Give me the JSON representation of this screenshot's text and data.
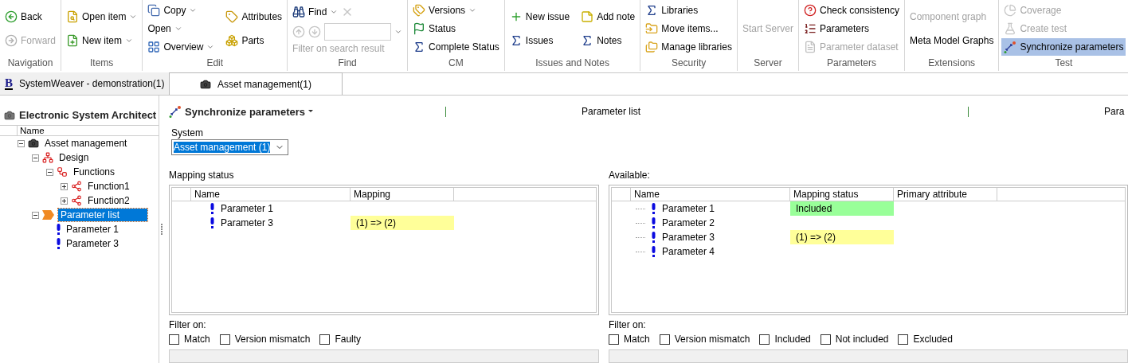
{
  "ribbon": {
    "groups": [
      {
        "label": "Navigation",
        "columns": [
          [
            {
              "kind": "button",
              "label": "Back",
              "dropdown": false,
              "disabled": false,
              "active": false
            },
            {
              "kind": "button",
              "label": "Forward",
              "dropdown": false,
              "disabled": true,
              "active": false
            }
          ]
        ]
      },
      {
        "label": "Items",
        "columns": [
          [
            {
              "kind": "button",
              "label": "Open item",
              "dropdown": true,
              "disabled": false,
              "active": false
            },
            {
              "kind": "button",
              "label": "New item",
              "dropdown": true,
              "disabled": false,
              "active": false
            }
          ]
        ]
      },
      {
        "label": "Edit",
        "columns": [
          [
            {
              "kind": "button",
              "label": "Copy",
              "dropdown": true,
              "disabled": false,
              "active": false
            },
            {
              "kind": "button",
              "label": "Open",
              "dropdown": true,
              "disabled": false,
              "active": false
            },
            {
              "kind": "button",
              "label": "Overview",
              "dropdown": true,
              "disabled": false,
              "active": false
            }
          ],
          [
            {
              "kind": "button",
              "label": "Attributes",
              "dropdown": false,
              "disabled": false,
              "active": false
            },
            {
              "kind": "button",
              "label": "Parts",
              "dropdown": false,
              "disabled": false,
              "active": false
            }
          ]
        ]
      },
      {
        "label": "Find",
        "columns": [
          [
            {
              "kind": "row",
              "items": [
                {
                  "kind": "button",
                  "label": "Find",
                  "dropdown": true,
                  "disabled": false,
                  "active": false
                },
                {
                  "kind": "icon-button",
                  "disabled": true
                }
              ]
            },
            {
              "kind": "row",
              "items": [
                {
                  "kind": "icon-button",
                  "disabled": true
                },
                {
                  "kind": "icon-button",
                  "disabled": true
                },
                {
                  "kind": "field"
                },
                {
                  "kind": "caret-button"
                }
              ]
            },
            {
              "kind": "caption",
              "label": "Filter on search result",
              "disabled": true
            }
          ]
        ]
      },
      {
        "label": "CM",
        "columns": [
          [
            {
              "kind": "button",
              "label": "Versions",
              "dropdown": true,
              "disabled": false,
              "active": false
            },
            {
              "kind": "button",
              "label": "Status",
              "dropdown": false,
              "disabled": false,
              "active": false
            },
            {
              "kind": "button",
              "label": "Complete Status",
              "dropdown": false,
              "disabled": false,
              "active": false
            }
          ]
        ]
      },
      {
        "label": "Issues and Notes",
        "columns": [
          [
            {
              "kind": "button",
              "label": "New issue",
              "dropdown": false,
              "disabled": false,
              "active": false
            },
            {
              "kind": "button",
              "label": "Issues",
              "dropdown": false,
              "disabled": false,
              "active": false
            }
          ],
          [
            {
              "kind": "button",
              "label": "Add note",
              "dropdown": false,
              "disabled": false,
              "active": false
            },
            {
              "kind": "button",
              "label": "Notes",
              "dropdown": false,
              "disabled": false,
              "active": false
            }
          ]
        ]
      },
      {
        "label": "Security",
        "columns": [
          [
            {
              "kind": "button",
              "label": "Libraries",
              "dropdown": false,
              "disabled": false,
              "active": false
            },
            {
              "kind": "button",
              "label": "Move items...",
              "dropdown": false,
              "disabled": false,
              "active": false
            },
            {
              "kind": "button",
              "label": "Manage libraries",
              "dropdown": false,
              "disabled": false,
              "active": false
            }
          ]
        ]
      },
      {
        "label": "Server",
        "columns": [
          [
            {
              "kind": "button",
              "label": "Start Server",
              "dropdown": false,
              "disabled": true,
              "active": false
            }
          ]
        ]
      },
      {
        "label": "Parameters",
        "columns": [
          [
            {
              "kind": "button",
              "label": "Check consistency",
              "dropdown": false,
              "disabled": false,
              "active": false
            },
            {
              "kind": "button",
              "label": "Parameters",
              "dropdown": false,
              "disabled": false,
              "active": false
            },
            {
              "kind": "button",
              "label": "Parameter dataset",
              "dropdown": false,
              "disabled": true,
              "active": false
            }
          ]
        ]
      },
      {
        "label": "Extensions",
        "columns": [
          [
            {
              "kind": "button",
              "label": "Component graph",
              "dropdown": false,
              "disabled": true,
              "active": false
            },
            {
              "kind": "button",
              "label": "Meta Model Graphs",
              "dropdown": false,
              "disabled": false,
              "active": false
            }
          ]
        ]
      },
      {
        "label": "Test",
        "columns": [
          [
            {
              "kind": "button",
              "label": "Coverage",
              "dropdown": false,
              "disabled": true,
              "active": false
            },
            {
              "kind": "button",
              "label": "Create test",
              "dropdown": false,
              "disabled": true,
              "active": false
            },
            {
              "kind": "button",
              "label": "Synchronize parameters",
              "dropdown": false,
              "disabled": false,
              "active": true
            }
          ]
        ]
      }
    ]
  },
  "document_tabs": [
    {
      "logo": "B",
      "label": "SystemWeaver - demonstration(1)",
      "selected": false
    },
    {
      "label": "Asset management(1)",
      "selected": true
    }
  ],
  "explorer": {
    "title": "Electronic System Architect",
    "column": "Name",
    "tree": [
      {
        "kind": "system",
        "label": "Asset management",
        "expanded": true,
        "selected": false,
        "children": [
          {
            "kind": "design",
            "label": "Design",
            "expanded": true,
            "selected": false,
            "children": [
              {
                "kind": "function-group",
                "label": "Functions",
                "expanded": true,
                "selected": false,
                "children": [
                  {
                    "kind": "function",
                    "label": "Function1",
                    "expanded": false,
                    "selected": false
                  },
                  {
                    "kind": "function",
                    "label": "Function2",
                    "expanded": false,
                    "selected": false
                  }
                ]
              }
            ]
          },
          {
            "kind": "parameter-list",
            "label": "Parameter list",
            "expanded": true,
            "selected": true,
            "children": [
              {
                "kind": "parameter",
                "label": "Parameter 1",
                "selected": false
              },
              {
                "kind": "parameter",
                "label": "Parameter 3",
                "selected": false
              }
            ]
          }
        ]
      }
    ]
  },
  "view": {
    "title": "Synchronize parameters",
    "context_labels": [
      "Parameter list",
      "Para"
    ],
    "system": {
      "label": "System",
      "value": "Asset management (1)",
      "value_selected": true
    },
    "panels": [
      {
        "label": "Mapping status",
        "columns": [
          "Name",
          "Mapping"
        ],
        "rows": [
          {
            "name": "Parameter 1"
          },
          {
            "name": "Parameter 3",
            "status": "(1) => (2)",
            "color": "#ffff99"
          }
        ],
        "filter_label": "Filter on:",
        "filters": [
          {
            "label": "Match",
            "checked": false
          },
          {
            "label": "Version mismatch",
            "checked": false
          },
          {
            "label": "Faulty",
            "checked": false
          }
        ]
      },
      {
        "label": "Available:",
        "columns": [
          "Name",
          "Mapping status",
          "Primary attribute"
        ],
        "rows": [
          {
            "name": "Parameter 1",
            "status": "Included",
            "color": "#99ff99"
          },
          {
            "name": "Parameter 2"
          },
          {
            "name": "Parameter 3",
            "status": "(1) => (2)",
            "color": "#ffff99"
          },
          {
            "name": "Parameter 4"
          }
        ],
        "filter_label": "Filter on:",
        "filters": [
          {
            "label": "Match",
            "checked": false
          },
          {
            "label": "Version mismatch",
            "checked": false
          },
          {
            "label": "Included",
            "checked": false
          },
          {
            "label": "Not included",
            "checked": false
          },
          {
            "label": "Excluded",
            "checked": false
          }
        ]
      }
    ]
  }
}
